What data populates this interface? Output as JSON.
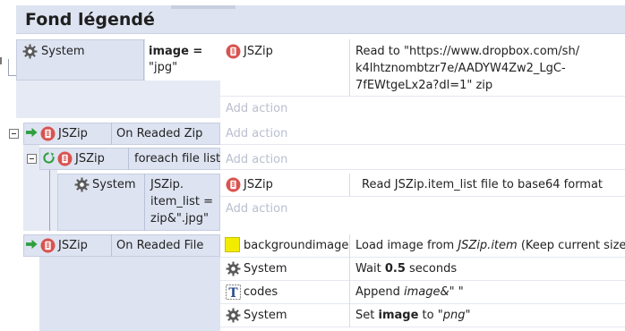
{
  "group": {
    "title": "Fond légendé"
  },
  "events": [
    {
      "id": "event1",
      "condition": {
        "object": "System",
        "icon": "gear-icon",
        "param_label": "image =",
        "param_value": "\"jpg\""
      },
      "actions": [
        {
          "object": "JSZip",
          "icon": "jszip-icon",
          "line1": "Read to \"https://www.dropbox.com/sh/",
          "line2": "k4lhtznombtzr7e/AADYW4Zw2_LgC-",
          "line3": "7fEWtgeLx2a?dl=1\" zip"
        }
      ],
      "add_action": "Add action"
    },
    {
      "id": "event2",
      "condition": {
        "object": "JSZip",
        "icon": "jszip-icon",
        "trigger_icon": "trigger-arrow-icon",
        "label": "On Readed Zip"
      },
      "add_action": "Add action"
    },
    {
      "id": "event3",
      "condition": {
        "object": "JSZip",
        "icon": "jszip-icon",
        "loop_icon": "loop-icon",
        "label": "foreach file list"
      },
      "add_action": "Add action"
    },
    {
      "id": "event4",
      "condition": {
        "object": "System",
        "icon": "gear-icon",
        "line1": "JSZip.",
        "line2": "item_list =",
        "line3": "zip&\".jpg\""
      },
      "actions": [
        {
          "object": "JSZip",
          "icon": "jszip-icon",
          "text": "Read JSZip.item_list  file to base64 format"
        }
      ],
      "add_action": "Add action"
    },
    {
      "id": "event5",
      "condition": {
        "object": "JSZip",
        "icon": "jszip-icon",
        "trigger_icon": "trigger-arrow-icon",
        "label": "On Readed File"
      },
      "actions": [
        {
          "object": "backgroundimage",
          "icon": "sprite-icon",
          "text_pre": "Load image from ",
          "text_ital": "JSZip.item",
          "text_post": " (Keep current size)"
        },
        {
          "object": "System",
          "icon": "gear-icon",
          "text_pre": "Wait ",
          "text_bold": "0.5",
          "text_post": " seconds"
        },
        {
          "object": "codes",
          "icon": "text-object-icon",
          "text_pre": "Append ",
          "text_ital": "image&\" \""
        },
        {
          "object": "System",
          "icon": "gear-icon",
          "text_pre": "Set ",
          "text_bold": "image",
          "text_mid": " to ",
          "text_ital": "\"png\""
        }
      ]
    }
  ],
  "colors": {
    "condition_bg": "#dde3f1",
    "add_action": "#b9bfcf",
    "jszip_red": "#d9534f",
    "sprite_yellow": "#f2ec00",
    "trigger_green": "#2e9e3e"
  }
}
